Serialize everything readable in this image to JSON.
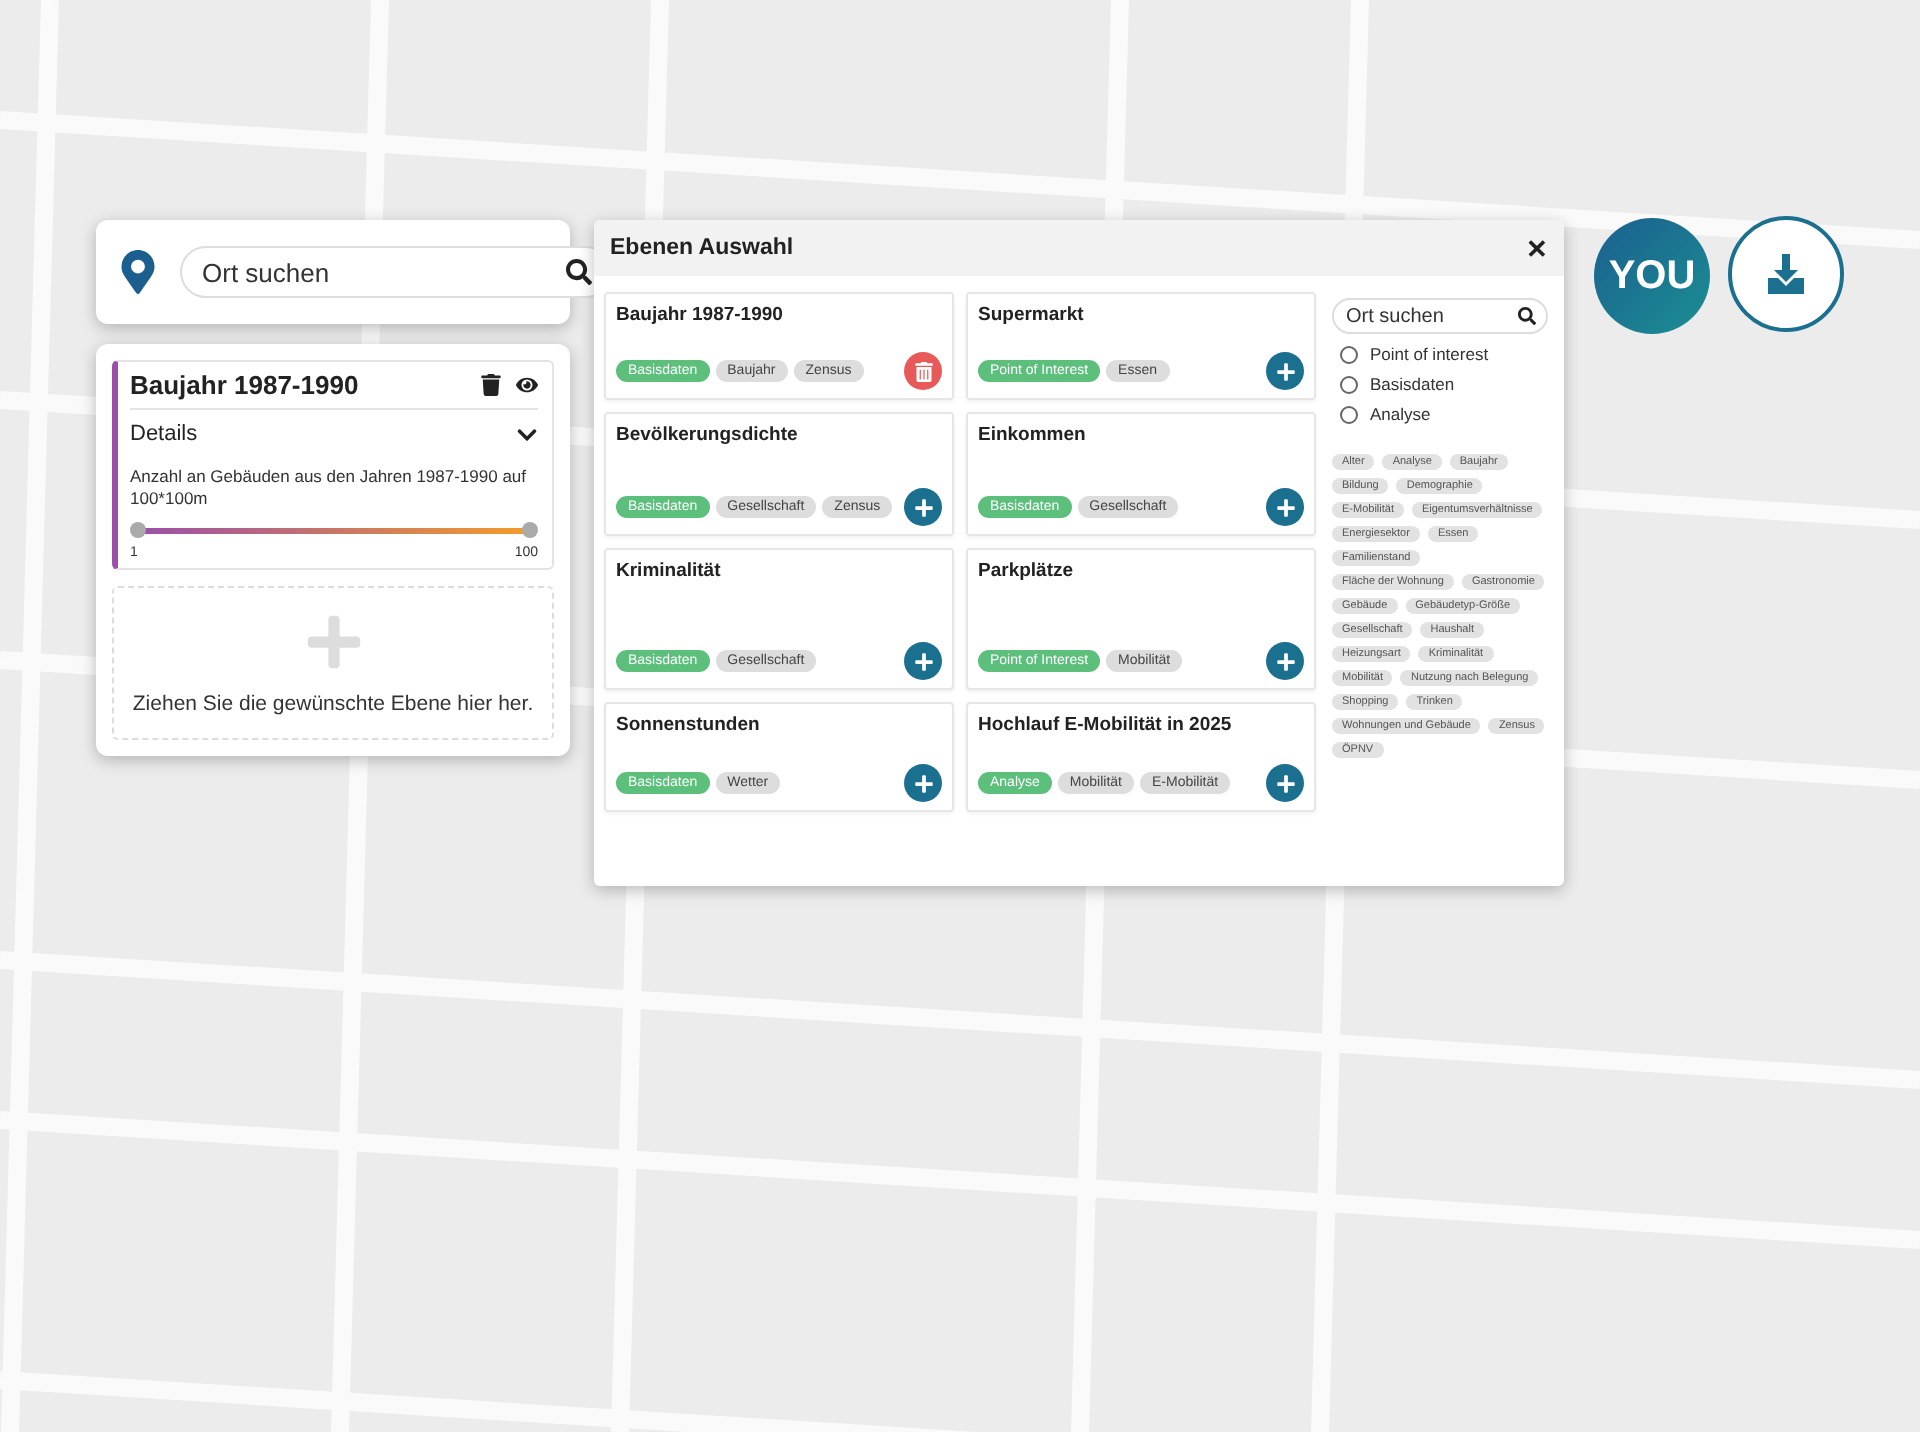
{
  "search": {
    "placeholder": "Ort suchen"
  },
  "active_layer": {
    "title": "Baujahr 1987-1990",
    "details_label": "Details",
    "expanded": true,
    "description": "Anzahl an Gebäuden aus den Jahren 1987-1990 auf 100*100m",
    "level": 1,
    "min_label": "1",
    "max_label": "100"
  },
  "drop_zone": {
    "text": "Ziehen Sie die gewünschte Ebene hier her."
  },
  "dialog": {
    "title": "Ebenen Auswahl",
    "close": "✕",
    "layers": [
      {
        "title": "Baujahr 1987-1990",
        "kind": "remove",
        "tags": [
          {
            "label": "Basisdaten",
            "kind": "category"
          },
          {
            "label": "Baujahr",
            "kind": "plain"
          },
          {
            "label": "Zensus",
            "kind": "plain"
          }
        ]
      },
      {
        "title": "Supermarkt",
        "kind": "add",
        "tags": [
          {
            "label": "Point of Interest",
            "kind": "category"
          },
          {
            "label": "Essen",
            "kind": "plain"
          }
        ]
      },
      {
        "title": "Bevölkerungsdichte",
        "kind": "add",
        "tags": [
          {
            "label": "Basisdaten",
            "kind": "category"
          },
          {
            "label": "Gesellschaft",
            "kind": "plain"
          },
          {
            "label": "Zensus",
            "kind": "plain"
          }
        ]
      },
      {
        "title": "Einkommen",
        "kind": "add",
        "tags": [
          {
            "label": "Basisdaten",
            "kind": "category"
          },
          {
            "label": "Gesellschaft",
            "kind": "plain"
          }
        ]
      },
      {
        "title": "Kriminalität",
        "kind": "add",
        "tags": [
          {
            "label": "Basisdaten",
            "kind": "category"
          },
          {
            "label": "Gesellschaft",
            "kind": "plain"
          }
        ]
      },
      {
        "title": "Parkplätze",
        "kind": "add",
        "tags": [
          {
            "label": "Point of Interest",
            "kind": "category"
          },
          {
            "label": "Mobilität",
            "kind": "plain"
          }
        ]
      },
      {
        "title": "Sonnenstunden",
        "kind": "add",
        "tags": [
          {
            "label": "Basisdaten",
            "kind": "category"
          },
          {
            "label": "Wetter",
            "kind": "plain"
          }
        ]
      },
      {
        "title": "Hochlauf E-Mobilität in 2025",
        "kind": "add",
        "tags": [
          {
            "label": "Analyse",
            "kind": "category"
          },
          {
            "label": "Mobilität",
            "kind": "plain"
          },
          {
            "label": "E-Mobilität",
            "kind": "plain"
          }
        ]
      }
    ],
    "filter_search": {
      "placeholder": "Ort suchen"
    },
    "filters": [
      {
        "label": "Point of interest",
        "selected": false
      },
      {
        "label": "Basisdaten",
        "selected": false
      },
      {
        "label": "Analyse",
        "selected": false
      }
    ],
    "keywords": [
      "Alter",
      "Analyse",
      "Baujahr",
      "Bildung",
      "Demographie",
      "E-Mobilität",
      "Eigentumsverhältnisse",
      "Energiesektor",
      "Essen",
      "Familienstand",
      "Fläche der Wohnung",
      "Gastronomie",
      "Gebäude",
      "Gebäudetyp-Größe",
      "Gesellschaft",
      "Haushalt",
      "Heizungsart",
      "Kriminalität",
      "Mobilität",
      "Nutzung nach Belegung",
      "Shopping",
      "Trinken",
      "Wohnungen und Gebäude",
      "Zensus",
      "ÖPNV"
    ]
  },
  "profile_button": {
    "label": "YOU"
  }
}
